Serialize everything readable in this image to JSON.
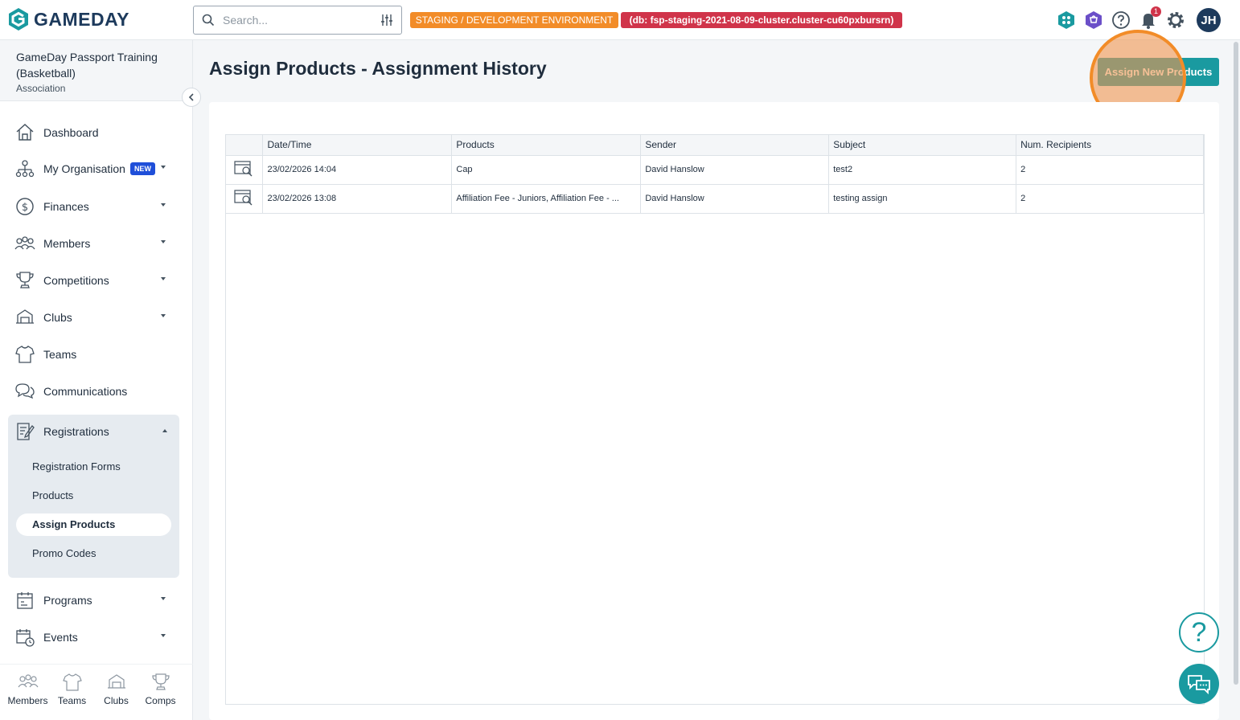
{
  "brand": {
    "name": "GAMEDAY"
  },
  "search": {
    "placeholder": "Search..."
  },
  "env": {
    "staging_label": "STAGING / DEVELOPMENT ENVIRONMENT",
    "db_label": "(db: fsp-staging-2021-08-09-cluster.cluster-cu60pxbursrn)"
  },
  "header": {
    "notification_count": "1",
    "avatar_initials": "JH"
  },
  "org": {
    "name": "GameDay Passport Training (Basketball)",
    "type": "Association"
  },
  "nav": {
    "dashboard": "Dashboard",
    "my_org": "My Organisation",
    "new_badge": "NEW",
    "finances": "Finances",
    "members": "Members",
    "competitions": "Competitions",
    "clubs": "Clubs",
    "teams": "Teams",
    "communications": "Communications",
    "registrations": "Registrations",
    "programs": "Programs",
    "events": "Events"
  },
  "registrations_sub": {
    "forms": "Registration Forms",
    "products": "Products",
    "assign": "Assign Products",
    "promo": "Promo Codes"
  },
  "bottom_nav": {
    "members": "Members",
    "teams": "Teams",
    "clubs": "Clubs",
    "comps": "Comps"
  },
  "page": {
    "title": "Assign Products - Assignment History",
    "assign_button": "Assign New Products"
  },
  "table": {
    "headers": [
      "Date/Time",
      "Products",
      "Sender",
      "Subject",
      "Num. Recipients"
    ],
    "rows": [
      {
        "datetime": "23/02/2026 14:04",
        "products": "Cap",
        "sender": "David Hanslow",
        "subject": "test2",
        "recipients": "2"
      },
      {
        "datetime": "23/02/2026 13:08",
        "products": "Affiliation Fee - Juniors, Affiliation Fee - ...",
        "sender": "David Hanslow",
        "subject": "testing assign",
        "recipients": "2"
      }
    ]
  },
  "colors": {
    "accent": "#1a9aa0",
    "brand": "#1d3a5c",
    "staging": "#f28c28",
    "db": "#d0344a",
    "new_badge": "#1f4fd9"
  },
  "help": {
    "symbol": "?"
  }
}
